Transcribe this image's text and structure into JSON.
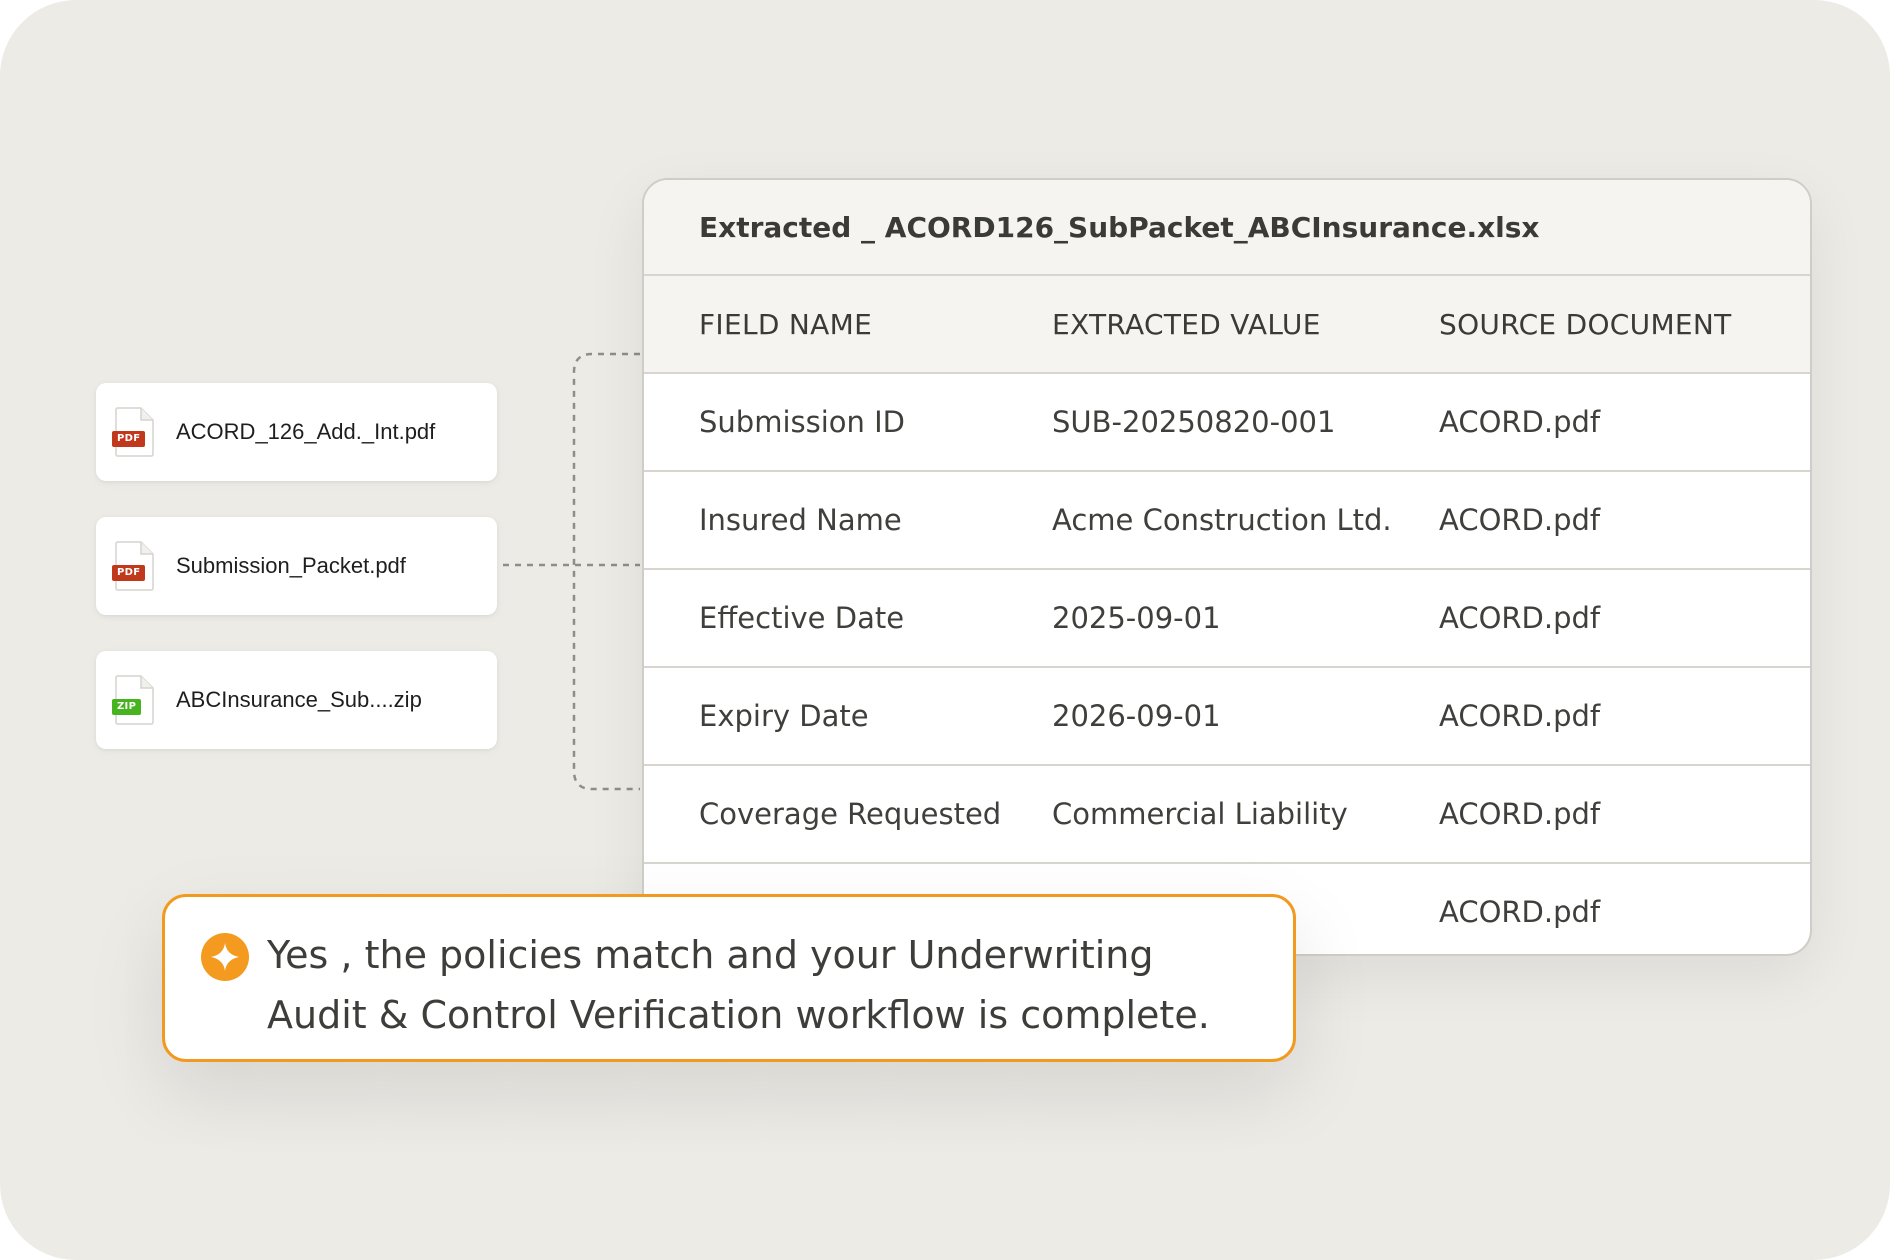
{
  "files": [
    {
      "name": "ACORD_126_Add._Int.pdf",
      "type": "PDF",
      "badge_color": "#c0391d"
    },
    {
      "name": "Submission_Packet.pdf",
      "type": "PDF",
      "badge_color": "#c0391d"
    },
    {
      "name": "ABCInsurance_Sub....zip",
      "type": "ZIP",
      "badge_color": "#46b31f"
    }
  ],
  "sheet": {
    "title": "Extracted _ ACORD126_SubPacket_ABCInsurance.xlsx",
    "columns": [
      "FIELD NAME",
      "EXTRACTED VALUE",
      "SOURCE DOCUMENT"
    ],
    "rows": [
      [
        "Submission ID",
        "SUB-20250820-001",
        "ACORD.pdf"
      ],
      [
        "Insured Name",
        "Acme Construction Ltd.",
        "ACORD.pdf"
      ],
      [
        "Effective Date",
        "2025-09-01",
        "ACORD.pdf"
      ],
      [
        "Expiry Date",
        "2026-09-01",
        "ACORD.pdf"
      ],
      [
        "Coverage Requested",
        "Commercial Liability",
        "ACORD.pdf"
      ],
      [
        "",
        "",
        "ACORD.pdf"
      ]
    ]
  },
  "message": {
    "line1": "Yes , the policies match and your Underwriting",
    "line2": "Audit & Control Verification workflow is complete.",
    "icon": "sparkle-icon",
    "accent_color": "#f29a1f"
  }
}
